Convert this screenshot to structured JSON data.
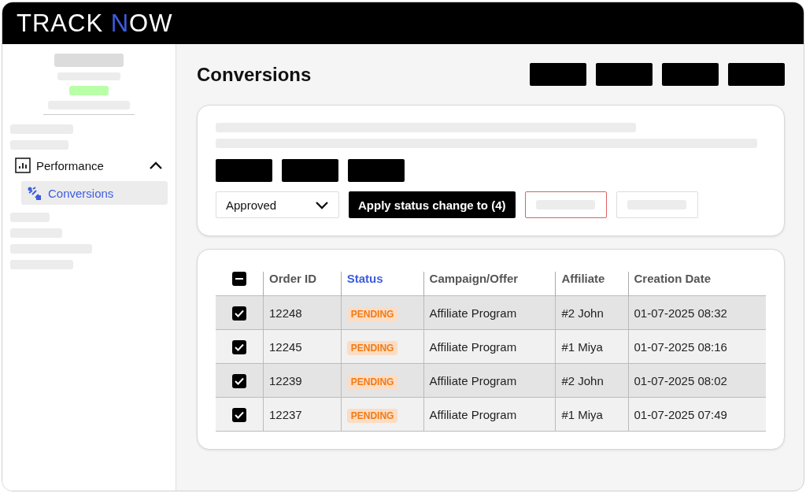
{
  "logo": {
    "parts": [
      {
        "text": "TRACK ",
        "color": "#ffffff"
      },
      {
        "text": "N",
        "color": "#3d5ce0"
      },
      {
        "text": "OW",
        "color": "#ffffff"
      }
    ]
  },
  "sidebar": {
    "section": {
      "label": "Performance",
      "expanded": true
    },
    "items": [
      {
        "label": "Conversions",
        "selected": true
      }
    ]
  },
  "page": {
    "title": "Conversions"
  },
  "actions": {
    "status_select": {
      "value": "Approved"
    },
    "apply_button": "Apply status change to (4)"
  },
  "table": {
    "select_all": {
      "indeterminate": true
    },
    "columns": [
      {
        "label": "Order ID",
        "active": false
      },
      {
        "label": "Status",
        "active": true
      },
      {
        "label": "Campaign/Offer",
        "active": false
      },
      {
        "label": "Affiliate",
        "active": false
      },
      {
        "label": "Creation Date",
        "active": false
      }
    ],
    "rows": [
      {
        "checked": true,
        "order_id": "12248",
        "status": "PENDING",
        "campaign": "Affiliate Program",
        "affiliate": "#2 John",
        "date": "01-07-2025 08:32"
      },
      {
        "checked": true,
        "order_id": "12245",
        "status": "PENDING",
        "campaign": "Affiliate Program",
        "affiliate": "#1 Miya",
        "date": "01-07-2025 08:16"
      },
      {
        "checked": true,
        "order_id": "12239",
        "status": "PENDING",
        "campaign": "Affiliate Program",
        "affiliate": "#2 John",
        "date": "01-07-2025 08:02"
      },
      {
        "checked": true,
        "order_id": "12237",
        "status": "PENDING",
        "campaign": "Affiliate Program",
        "affiliate": "#1 Miya",
        "date": "01-07-2025 07:49"
      }
    ]
  }
}
